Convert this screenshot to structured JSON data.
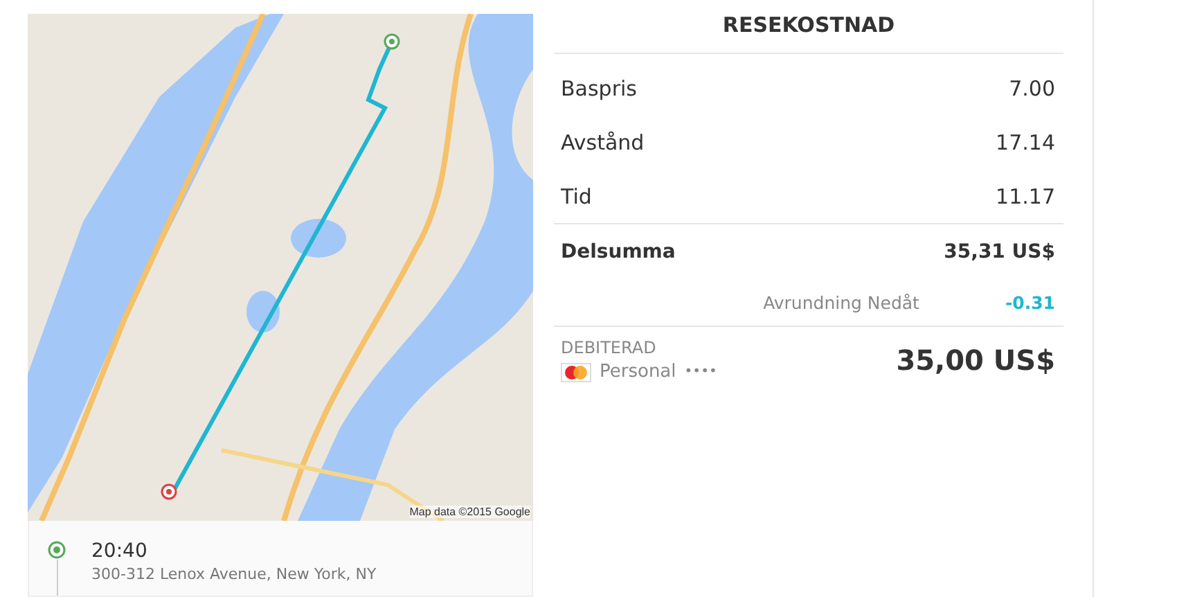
{
  "map": {
    "attribution": "Map data ©2015 Google"
  },
  "trip": {
    "time": "20:40",
    "address": "300-312 Lenox Avenue, New York, NY"
  },
  "fare": {
    "title": "RESEKOSTNAD",
    "items": [
      {
        "kind": "line",
        "label": "Baspris",
        "value": "7.00"
      },
      {
        "kind": "line",
        "label": "Avstånd",
        "value": "17.14"
      },
      {
        "kind": "line",
        "label": "Tid",
        "value": "11.17"
      },
      {
        "kind": "subtotal",
        "label": "Delsumma",
        "value": "35,31 US$"
      },
      {
        "kind": "rounding",
        "label": "Avrundning Nedåt",
        "value": "-0.31"
      }
    ],
    "charged": {
      "label": "DEBITERAD",
      "card": "Personal",
      "mask": "••••",
      "amount": "35,00 US$"
    }
  }
}
